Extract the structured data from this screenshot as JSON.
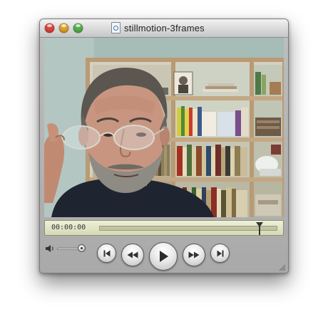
{
  "window": {
    "title": "stillmotion-3frames",
    "file_icon": "quicktime-movie-file-icon",
    "traffic_lights": {
      "close": "#e0443e",
      "minimize": "#e2a52a",
      "zoom": "#56b14a"
    }
  },
  "video": {
    "content": "video-frame"
  },
  "timeline": {
    "current_time": "00:00:00",
    "playhead_position": 0.9
  },
  "controls": {
    "volume_icon": "speaker-icon",
    "volume_level": 0.85,
    "buttons": [
      {
        "name": "go-to-start",
        "icon": "skip-back-icon"
      },
      {
        "name": "rewind",
        "icon": "rewind-icon"
      },
      {
        "name": "play",
        "icon": "play-icon"
      },
      {
        "name": "fast-forward",
        "icon": "fast-forward-icon"
      },
      {
        "name": "go-to-end",
        "icon": "skip-forward-icon"
      }
    ]
  },
  "colors": {
    "timebar_bg": "#e4e6c6",
    "window_chrome": "#c0c0c0"
  }
}
